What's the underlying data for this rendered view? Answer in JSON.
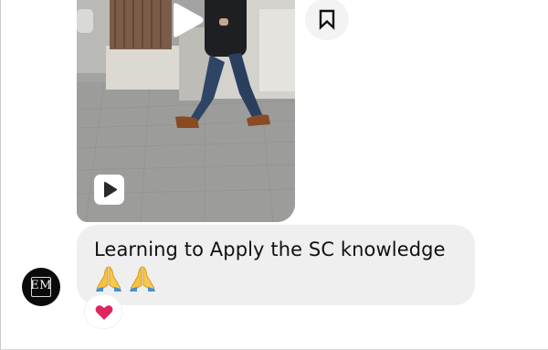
{
  "conversation": {
    "shared_reel": {
      "play_icon": "play-icon",
      "reel_badge_icon": "reel-play-icon"
    },
    "save_button": {
      "icon": "bookmark-icon"
    },
    "message": {
      "text": "Learning to Apply the SC knowledge",
      "emojis": [
        "folded-hands-emoji",
        "folded-hands-emoji"
      ]
    },
    "sender_avatar": {
      "initials": "EM"
    },
    "reaction": {
      "icon": "red-heart-emoji"
    }
  },
  "colors": {
    "bubble_bg": "#efefef",
    "save_button_bg": "#f3f3f4",
    "avatar_bg": "#0b0b0b",
    "heart": "#e0245e",
    "text": "#111111"
  }
}
